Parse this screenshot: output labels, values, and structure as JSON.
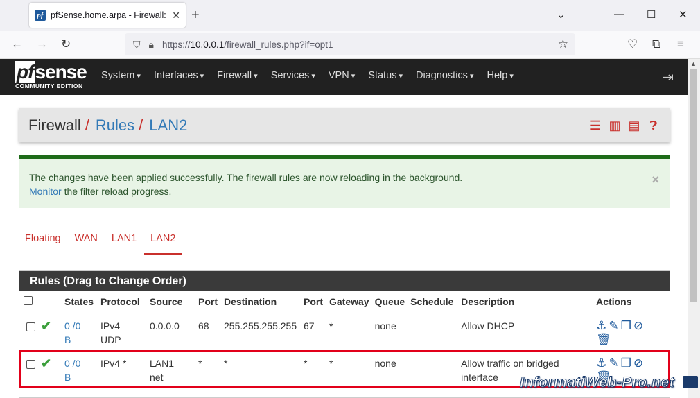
{
  "browser": {
    "tab_title": "pfSense.home.arpa - Firewall: Rules",
    "url_scheme": "https://",
    "url_host": "10.0.0.1",
    "url_path": "/firewall_rules.php?if=opt1"
  },
  "header": {
    "logo_text": "sense",
    "logo_prefix": "pf",
    "logo_sub": "COMMUNITY EDITION",
    "menu": [
      "System",
      "Interfaces",
      "Firewall",
      "Services",
      "VPN",
      "Status",
      "Diagnostics",
      "Help"
    ]
  },
  "breadcrumb": {
    "first": "Firewall",
    "second": "Rules",
    "third": "LAN2",
    "sep": "/"
  },
  "alert": {
    "line1": "The changes have been applied successfully. The firewall rules are now reloading in the background.",
    "link": "Monitor",
    "line2_rest": " the filter reload progress."
  },
  "tabs": [
    "Floating",
    "WAN",
    "LAN1",
    "LAN2"
  ],
  "rules": {
    "title": "Rules (Drag to Change Order)",
    "columns": [
      "States",
      "Protocol",
      "Source",
      "Port",
      "Destination",
      "Port",
      "Gateway",
      "Queue",
      "Schedule",
      "Description",
      "Actions"
    ],
    "rows": [
      {
        "states": "0 /0",
        "states2": "B",
        "protocol": "IPv4",
        "protocol2": "UDP",
        "source": "0.0.0.0",
        "source2": "",
        "port": "68",
        "destination": "255.255.255.255",
        "dport": "67",
        "gateway": "*",
        "queue": "none",
        "schedule": "",
        "description": "Allow DHCP",
        "description2": ""
      },
      {
        "states": "0 /0",
        "states2": "B",
        "protocol": "IPv4 *",
        "protocol2": "",
        "source": "LAN1",
        "source2": "net",
        "port": "*",
        "destination": "*",
        "dport": "*",
        "gateway": "*",
        "queue": "none",
        "schedule": "",
        "description": "Allow traffic on bridged",
        "description2": "interface"
      }
    ]
  },
  "watermark": "InformatiWeb-Pro.net"
}
